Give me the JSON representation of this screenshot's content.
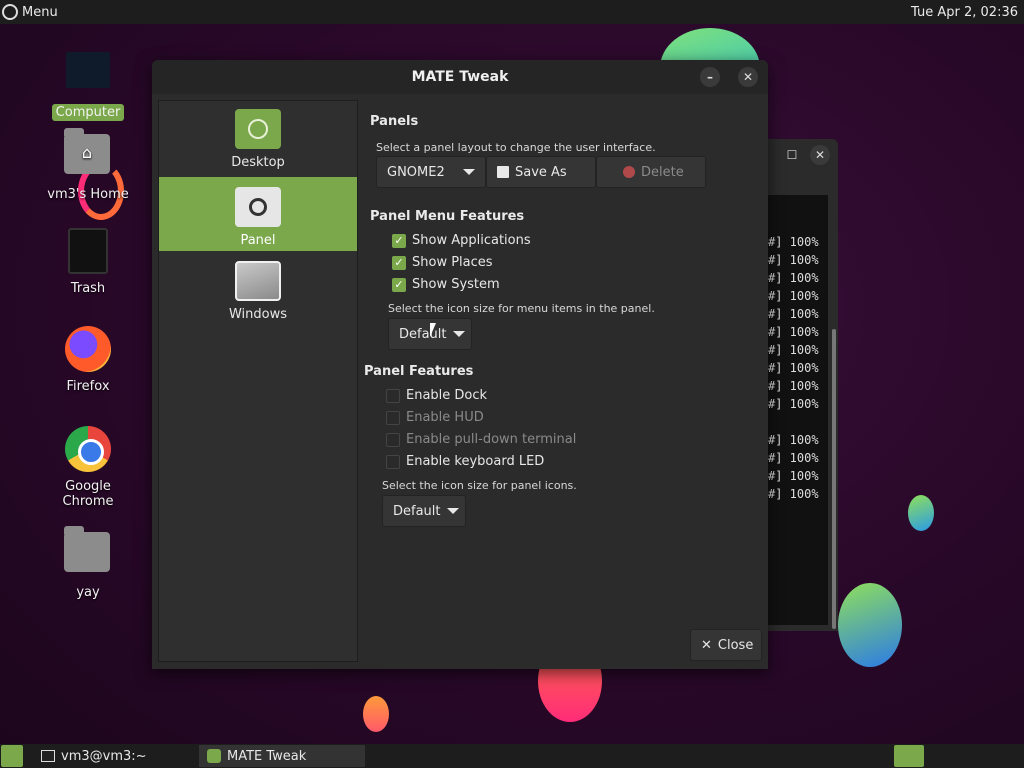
{
  "top_panel": {
    "menu_label": "Menu",
    "clock": "Tue Apr  2, 02:36"
  },
  "desktop_icons": [
    {
      "label": "Computer",
      "icon": "computer-icon"
    },
    {
      "label": "vm3's Home",
      "icon": "home-folder-icon"
    },
    {
      "label": "Trash",
      "icon": "trash-icon"
    },
    {
      "label": "Firefox",
      "icon": "firefox-icon"
    },
    {
      "label": "Google Chrome",
      "icon": "chrome-icon"
    },
    {
      "label": "yay",
      "icon": "folder-icon"
    }
  ],
  "terminal": {
    "lines": [
      "#] 100%",
      "#] 100%",
      "#] 100%",
      "#] 100%",
      "#] 100%",
      "#] 100%",
      "#] 100%",
      "#] 100%",
      "#] 100%",
      "#] 100%",
      "#] 100%",
      "#] 100%",
      "#] 100%",
      "#] 100%"
    ]
  },
  "dialog": {
    "title": "MATE Tweak",
    "sidebar": [
      {
        "label": "Desktop",
        "active": false
      },
      {
        "label": "Panel",
        "active": true
      },
      {
        "label": "Windows",
        "active": false
      }
    ],
    "panels": {
      "title": "Panels",
      "hint": "Select a panel layout to change the user interface.",
      "layout_value": "GNOME2",
      "save_as_label": "Save As",
      "delete_label": "Delete"
    },
    "panel_menu_features": {
      "title": "Panel Menu Features",
      "checks": [
        {
          "label": "Show Applications",
          "checked": true
        },
        {
          "label": "Show Places",
          "checked": true
        },
        {
          "label": "Show System",
          "checked": true
        }
      ],
      "icon_size_hint": "Select the icon size for menu items in the panel.",
      "icon_size_value": "Default"
    },
    "panel_features": {
      "title": "Panel Features",
      "checks": [
        {
          "label": "Enable Dock",
          "checked": false,
          "enabled": true
        },
        {
          "label": "Enable HUD",
          "checked": false,
          "enabled": false
        },
        {
          "label": "Enable pull-down terminal",
          "checked": false,
          "enabled": false
        },
        {
          "label": "Enable keyboard LED",
          "checked": false,
          "enabled": true
        }
      ],
      "icon_size_hint": "Select the icon size for panel icons.",
      "icon_size_value": "Default"
    },
    "close_label": "Close"
  },
  "bottom_panel": {
    "tasks": [
      {
        "label": "vm3@vm3:~",
        "active": false
      },
      {
        "label": "MATE Tweak",
        "active": true
      }
    ]
  },
  "colors": {
    "accent": "#7aa84a",
    "panel_bg": "#1d1d1d",
    "dialog_bg": "#2b2b2b"
  }
}
